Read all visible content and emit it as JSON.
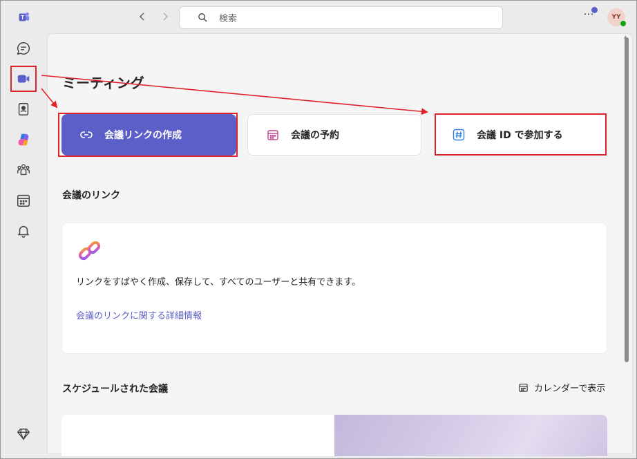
{
  "search": {
    "placeholder": "検索"
  },
  "avatar": {
    "initials": "YY"
  },
  "page": {
    "title": "ミーティング"
  },
  "actions": {
    "create_link": "会議リンクの作成",
    "schedule": "会議の予約",
    "join_by_id": "会議 ID で参加する"
  },
  "meeting_links": {
    "section_title": "会議のリンク",
    "description": "リンクをすばやく作成、保存して、すべてのユーザーと共有できます。",
    "learn_more": "会議のリンクに関する詳細情報"
  },
  "scheduled": {
    "section_title": "スケジュールされた会議",
    "calendar_view": "カレンダーで表示"
  },
  "colors": {
    "brand": "#5b5fc7",
    "annotation": "#e0232b",
    "presence": "#13a10e"
  }
}
